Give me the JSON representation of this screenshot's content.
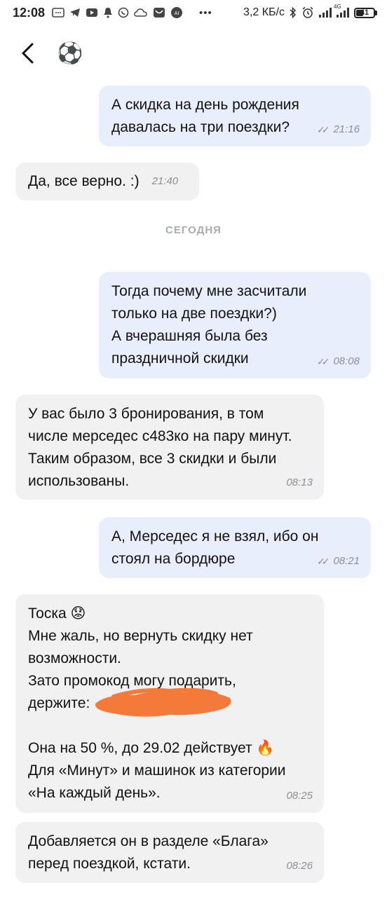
{
  "status_bar": {
    "time": "12:08",
    "net_speed": "3,2 КБ/с",
    "network_type": "4G",
    "battery": "41",
    "icons_left": [
      "message-icon",
      "telegram-icon",
      "youtube-icon",
      "notification-icon",
      "whatsapp-icon",
      "weather-icon",
      "mail-icon",
      "app-icon"
    ],
    "icons_right": [
      "bluetooth-icon",
      "alarm-icon",
      "signal-icon",
      "signal-4g-icon",
      "battery-icon"
    ]
  },
  "header": {
    "back_icon": "back-arrow-icon",
    "avatar_icon": "soccer-ball-icon",
    "avatar_glyph": "⚽"
  },
  "messages": [
    {
      "id": "m1",
      "direction": "out",
      "text": "А скидка на день рождения\nдавалась на три поездки?",
      "time": "21:16"
    },
    {
      "id": "m2",
      "direction": "in",
      "text": "Да, все верно. :)",
      "time": "21:40"
    },
    {
      "id": "m3",
      "direction": "out",
      "text": "Тогда почему мне засчитали\nтолько на две поездки?)\nА вчерашняя была без\nпраздничной скидки",
      "time": "08:08"
    },
    {
      "id": "m4",
      "direction": "in",
      "text": "У вас было 3 бронирования, в том\nчисле мерседес с483ко на пару минут.\nТаким образом, все 3 скидки и были\nиспользованы.",
      "time": "08:13"
    },
    {
      "id": "m5",
      "direction": "out",
      "text": "А, Мерседес я не взял, ибо он\nстоял на бордюре",
      "time": "08:21"
    },
    {
      "id": "m6",
      "direction": "in",
      "text": "Тоска 😟\nМне жаль, но вернуть скидку нет\nвозможности.\nЗато промокод могу подарить,\nдержите:\n\nОна на 50 %, до 29.02 действует 🔥\n Для «Минут» и машинок из категории\n«На каждый день».",
      "time": "08:25"
    },
    {
      "id": "m7",
      "direction": "in",
      "text": "Добавляется он в разделе «Блага»\nперед поездкой, кстати.",
      "time": "08:26"
    }
  ],
  "date_separator": "СЕГОДНЯ",
  "colors": {
    "outgoing_bubble": "#e8eefb",
    "incoming_bubble": "#f1f1f1",
    "meta_text": "#8d8f96",
    "redaction": "#f47a3a"
  }
}
